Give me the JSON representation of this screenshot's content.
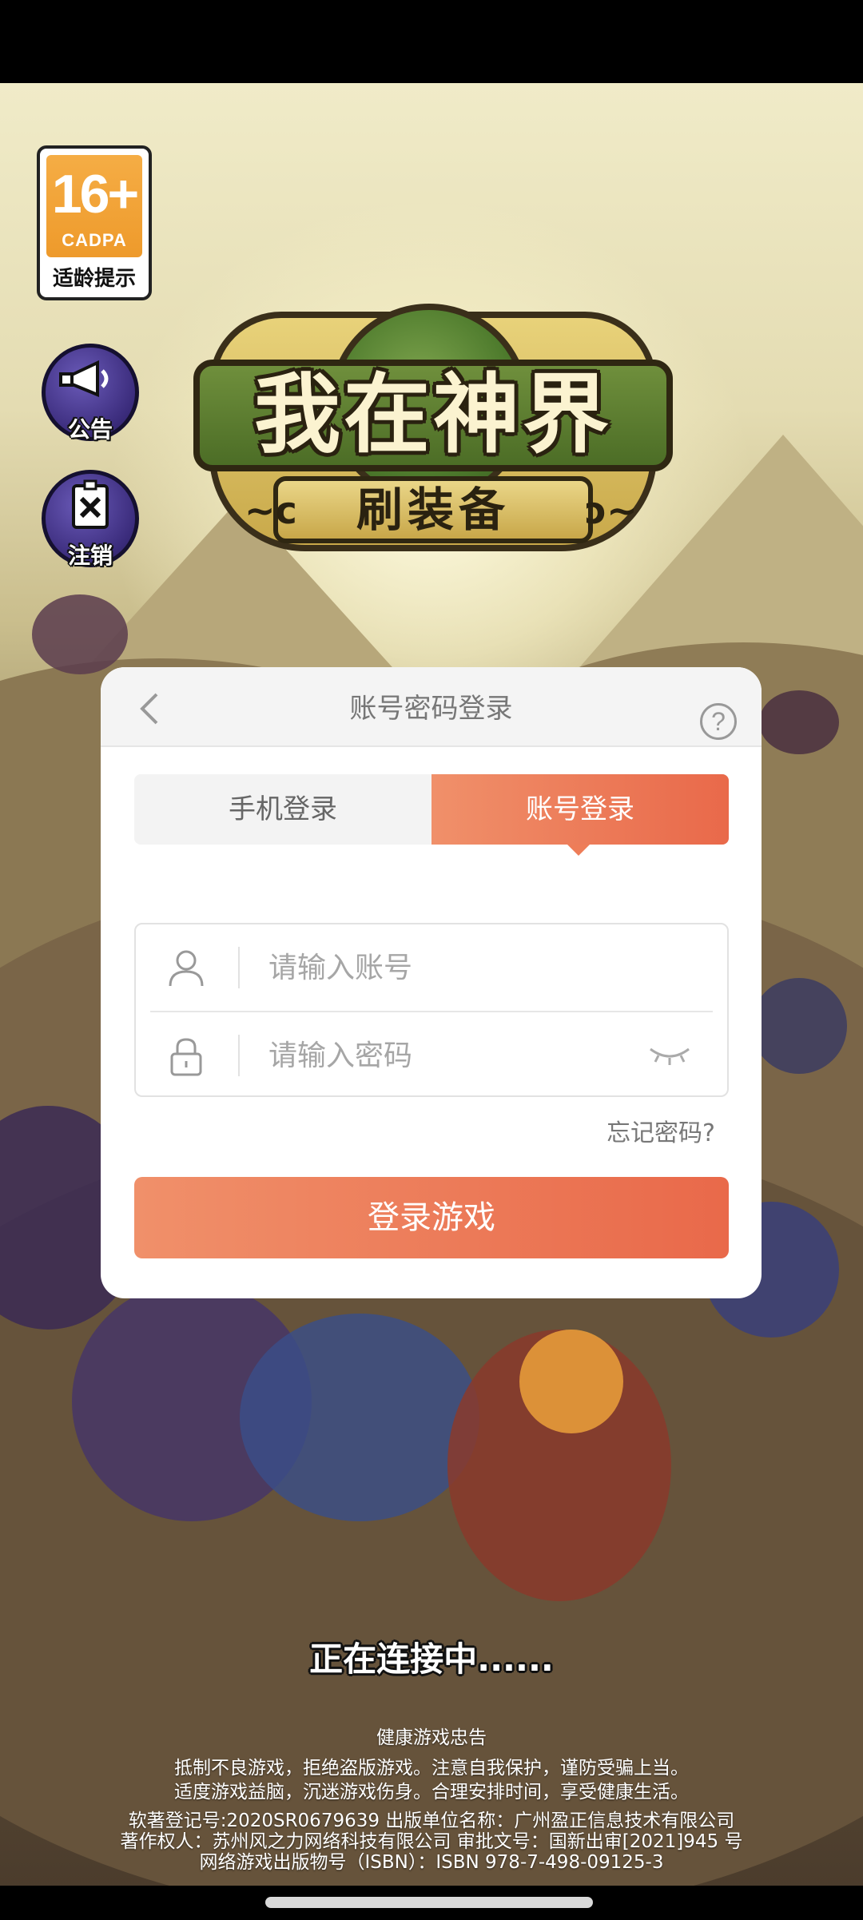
{
  "age_rating": {
    "age": "16+",
    "org": "CADPA",
    "label": "适龄提示"
  },
  "side_buttons": [
    {
      "icon": "megaphone-icon",
      "label": "公告"
    },
    {
      "icon": "logout-icon",
      "label": "注销"
    }
  ],
  "logo": {
    "title": "我在神界",
    "subtitle": "刷装备"
  },
  "login_dialog": {
    "title": "账号密码登录",
    "tabs": [
      {
        "label": "手机登录",
        "active": false
      },
      {
        "label": "账号登录",
        "active": true
      }
    ],
    "account_placeholder": "请输入账号",
    "password_placeholder": "请输入密码",
    "forgot_password": "忘记密码?",
    "login_button": "登录游戏"
  },
  "status": {
    "connecting": "正在连接中......"
  },
  "health_notice": {
    "heading": "健康游戏忠告",
    "line1": "抵制不良游戏，拒绝盗版游戏。注意自我保护，谨防受骗上当。",
    "line2": "适度游戏益脑，沉迷游戏伤身。合理安排时间，享受健康生活。"
  },
  "copyright": {
    "line1": "软著登记号:2020SR0679639 出版单位名称：广州盈正信息技术有限公司",
    "line2": "著作权人：苏州风之力网络科技有限公司 审批文号：国新出审[2021]945 号",
    "line3": "网络游戏出版物号（ISBN）：ISBN 978-7-498-09125-3"
  },
  "colors": {
    "accent": "#ec7a56",
    "accent_light": "#f0906a",
    "accent_dark": "#e9694a"
  }
}
